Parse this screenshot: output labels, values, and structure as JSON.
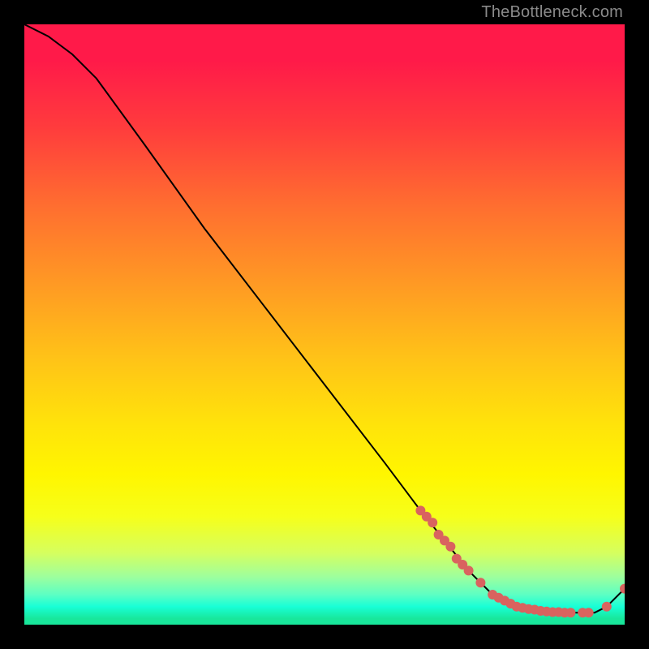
{
  "attribution": "TheBottleneck.com",
  "colors": {
    "dot_fill": "#d9635f",
    "curve_stroke": "#000000",
    "bg": "#000000"
  },
  "chart_data": {
    "type": "line",
    "title": "",
    "xlabel": "",
    "ylabel": "",
    "xlim": [
      0,
      100
    ],
    "ylim": [
      0,
      100
    ],
    "grid": false,
    "note": "Axes are unlabeled in the source image; x and y are normalized 0–100. Curve descends from top-left to a flat valley near y≈2 over x≈78–95, then rises slightly to y≈6 at x=100.",
    "series": [
      {
        "name": "bottleneck-curve",
        "x": [
          0,
          4,
          8,
          12,
          20,
          30,
          40,
          50,
          60,
          66,
          70,
          74,
          78,
          82,
          86,
          90,
          93,
          95,
          97,
          100
        ],
        "y": [
          100,
          98,
          95,
          91,
          80,
          66,
          53,
          40,
          27,
          19,
          14,
          9,
          5,
          3,
          2,
          2,
          2,
          2,
          3,
          6
        ]
      }
    ],
    "highlight_points": {
      "name": "dense-region-markers",
      "x": [
        66,
        67,
        68,
        69,
        70,
        71,
        72,
        73,
        74,
        76,
        78,
        79,
        80,
        81,
        82,
        83,
        84,
        85,
        86,
        87,
        88,
        89,
        90,
        91,
        93,
        94,
        97,
        100
      ],
      "y": [
        19,
        18,
        17,
        15,
        14,
        13,
        11,
        10,
        9,
        7,
        5,
        4.5,
        4,
        3.5,
        3,
        2.8,
        2.6,
        2.5,
        2.3,
        2.2,
        2.1,
        2.1,
        2,
        2,
        2,
        2,
        3,
        6
      ]
    }
  }
}
